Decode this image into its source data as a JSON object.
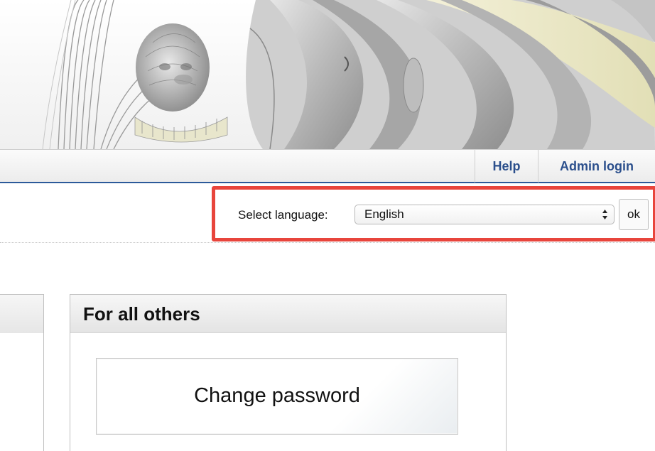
{
  "nav": {
    "help_label": "Help",
    "admin_login_label": "Admin login",
    "accent_color": "#2b4f8c"
  },
  "language": {
    "label": "Select language:",
    "selected": "English",
    "ok_label": "ok",
    "highlight_color": "#e8453c"
  },
  "panels": {
    "right_title": "For all others",
    "change_password_label": "Change password"
  }
}
